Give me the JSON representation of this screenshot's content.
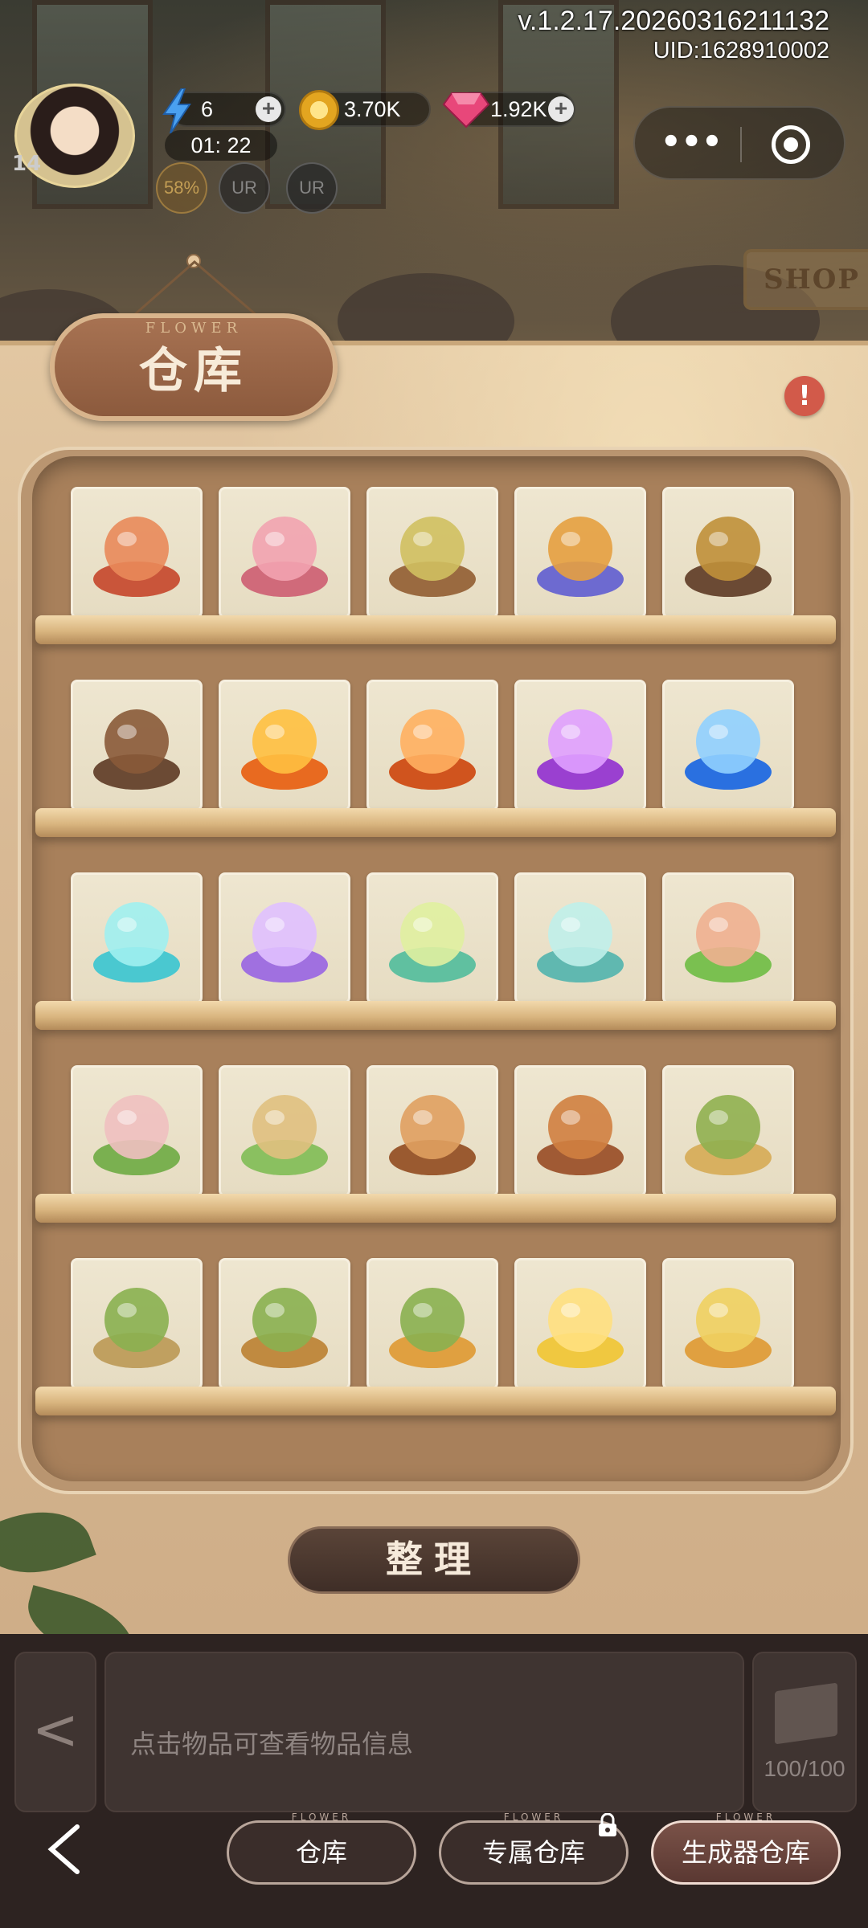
{
  "status": {
    "version": "v.1.2.17.20260316211132",
    "uid": "UID:1628910002"
  },
  "player": {
    "level": "14",
    "energy": "6",
    "energy_timer": "01: 22",
    "coins": "3.70K",
    "gems": "1.92K",
    "buffs": [
      "58%",
      "UR",
      "UR"
    ]
  },
  "scene": {
    "shop_sign": "SHOP"
  },
  "warehouse": {
    "sign_flower": "FLOWER",
    "title": "仓库",
    "alert": "!",
    "items": [
      [
        "flower-bed-red-icon",
        "flower-bed-pink-icon",
        "sprout-bed-icon",
        "teapot-stove-icon",
        "wood-stump-pot-icon"
      ],
      [
        "broken-stump-icon",
        "campfire-icon",
        "orange-vortex-icon",
        "purple-vortex-icon",
        "blue-vortex-icon"
      ],
      [
        "crystal-shard-icon",
        "purple-potion-icon",
        "green-potion-icon",
        "teal-bottle-icon",
        "garden-bridge-icon"
      ],
      [
        "flower-arch-garden-icon",
        "green-arch-garden-icon",
        "wooden-pavilion-icon",
        "tall-cabinet-icon",
        "small-cabinet-icon"
      ],
      [
        "picnic-basket-icon",
        "green-basket-icon",
        "round-basket-icon",
        "shopping-bag-icon",
        "yellow-wallet-icon"
      ]
    ],
    "sort_button": "整理"
  },
  "info": {
    "hint": "点击物品可查看物品信息",
    "capacity": "100/100"
  },
  "tabs": {
    "flower_label": "FLOWER",
    "items": [
      {
        "label": "仓库",
        "active": false
      },
      {
        "label": "专属仓库",
        "active": false,
        "locked": true
      },
      {
        "label": "生成器仓库",
        "active": true
      }
    ]
  },
  "colors": {
    "wood_light": "#e2c7a2",
    "shelf": "#a8805b",
    "alert": "#d25a4a",
    "tab_active": "#7a5248"
  }
}
